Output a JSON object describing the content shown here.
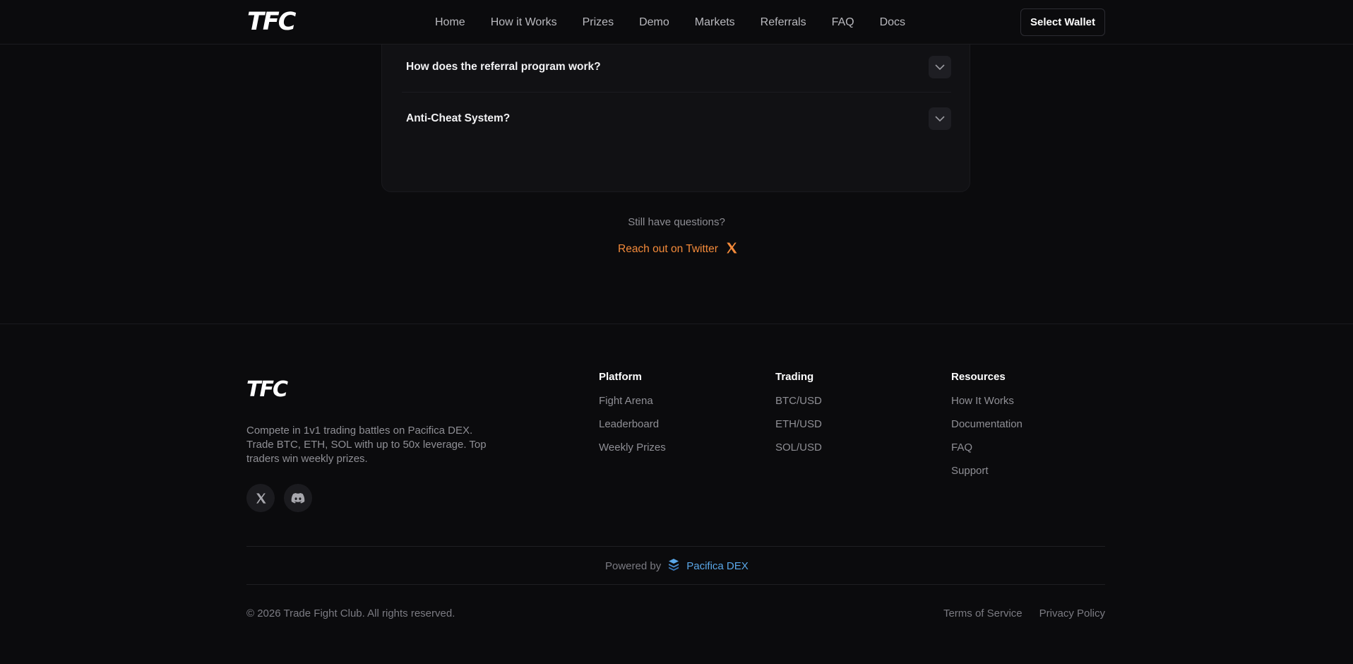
{
  "header": {
    "logo": "TFC",
    "nav": [
      "Home",
      "How it Works",
      "Prizes",
      "Demo",
      "Markets",
      "Referrals",
      "FAQ",
      "Docs"
    ],
    "wallet_button": "Select Wallet"
  },
  "faq": {
    "items": [
      {
        "question": ""
      },
      {
        "question": "How does the referral program work?"
      },
      {
        "question": "Anti-Cheat System?"
      }
    ]
  },
  "support": {
    "prompt": "Still have questions?",
    "link_label": "Reach out on Twitter",
    "link_color": "#f38a3a"
  },
  "footer": {
    "logo": "TFC",
    "description": "Compete in 1v1 trading battles on Pacifica DEX. Trade BTC, ETH, SOL with up to 50x leverage. Top traders win weekly prizes.",
    "socials": [
      "x-icon",
      "discord-icon"
    ],
    "columns": [
      {
        "title": "Platform",
        "links": [
          "Fight Arena",
          "Leaderboard",
          "Weekly Prizes"
        ]
      },
      {
        "title": "Trading",
        "links": [
          "BTC/USD",
          "ETH/USD",
          "SOL/USD"
        ]
      },
      {
        "title": "Resources",
        "links": [
          "How It Works",
          "Documentation",
          "FAQ",
          "Support"
        ]
      }
    ],
    "powered_by_label": "Powered by",
    "powered_by_name": "Pacifica DEX",
    "powered_color": "#5aa7e8",
    "copyright": "© 2026 Trade Fight Club. All rights reserved.",
    "legal": [
      "Terms of Service",
      "Privacy Policy"
    ]
  }
}
